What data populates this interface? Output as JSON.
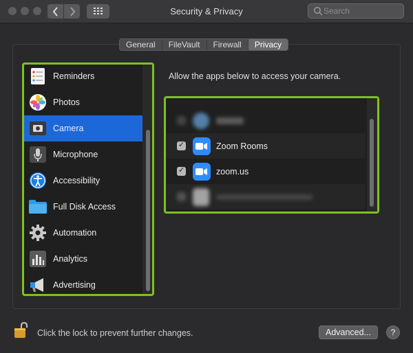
{
  "window": {
    "title": "Security & Privacy"
  },
  "toolbar": {
    "back_icon": "chevron-left-icon",
    "forward_icon": "chevron-right-icon",
    "grid_icon": "grid-icon",
    "search_placeholder": "Search"
  },
  "tabs": [
    {
      "label": "General"
    },
    {
      "label": "FileVault"
    },
    {
      "label": "Firewall"
    },
    {
      "label": "Privacy",
      "active": true
    }
  ],
  "sidebar": {
    "items": [
      {
        "label": "Reminders",
        "icon": "reminders-icon"
      },
      {
        "label": "Photos",
        "icon": "photos-icon"
      },
      {
        "label": "Camera",
        "icon": "camera-icon",
        "selected": true
      },
      {
        "label": "Microphone",
        "icon": "microphone-icon"
      },
      {
        "label": "Accessibility",
        "icon": "accessibility-icon"
      },
      {
        "label": "Full Disk Access",
        "icon": "folder-icon"
      },
      {
        "label": "Automation",
        "icon": "gear-icon"
      },
      {
        "label": "Analytics",
        "icon": "analytics-icon"
      },
      {
        "label": "Advertising",
        "icon": "megaphone-icon"
      }
    ]
  },
  "main": {
    "description": "Allow the apps below to access your camera.",
    "apps": [
      {
        "label": "Zoom Rooms",
        "checked": true,
        "icon": "zoom-rooms-icon"
      },
      {
        "label": "zoom.us",
        "checked": true,
        "icon": "zoom-icon"
      }
    ]
  },
  "footer": {
    "lock_text": "Click the lock to prevent further changes.",
    "advanced_label": "Advanced...",
    "help_label": "?"
  },
  "colors": {
    "accent": "#1c68d8",
    "highlight_border": "#7dc21e",
    "zoom_blue": "#2d8cff"
  }
}
